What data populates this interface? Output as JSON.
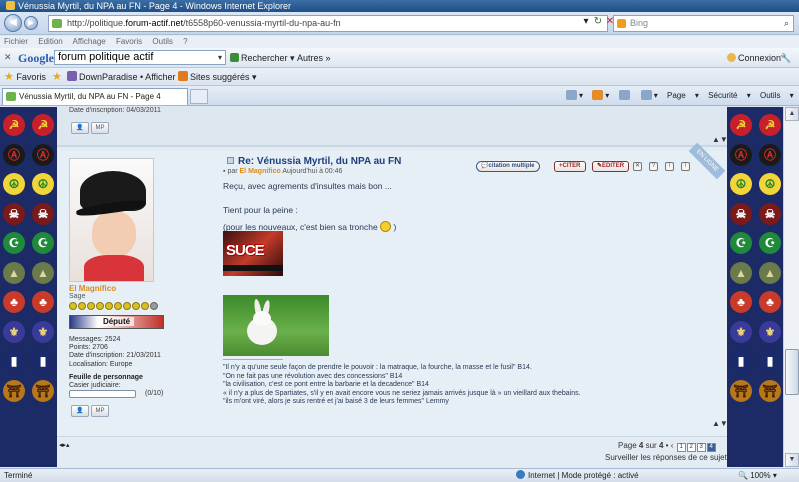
{
  "window": {
    "title": "Vénussia Myrtil, du NPA au FN - Page 4 - Windows Internet Explorer"
  },
  "address_bar": {
    "url_prefix": "http://politique.",
    "url_domain": "forum-actif.net",
    "url_rest": "/t6558p60-venussia-myrtil-du-npa-au-fn",
    "search_engine": "Bing"
  },
  "menu": [
    "Fichier",
    "Edition",
    "Affichage",
    "Favoris",
    "Outils",
    "?"
  ],
  "google_toolbar": {
    "logo": "Google",
    "query": "forum politique actif",
    "search_label": "Rechercher",
    "others_label": "Autres",
    "connect_label": "Connexion"
  },
  "favorites_bar": {
    "favorites_label": "Favoris",
    "items": [
      "DownParadise • Afficher l...",
      "Sites suggérés"
    ]
  },
  "tabs": {
    "active": "Vénussia Myrtil, du NPA au FN - Page 4"
  },
  "command_bar": {
    "page": "Page",
    "security": "Sécurité",
    "tools": "Outils"
  },
  "previous_post": {
    "registration_date": "Date d'inscription: 04/03/2011"
  },
  "post": {
    "title": "Re: Vénussia Myrtil, du NPA au FN",
    "by_label": "par",
    "author": "El Magnifico",
    "time": "Aujourd'hui à 00:46",
    "actions": {
      "multi_quote": "citation multiple",
      "quote": "CITER",
      "edit": "EDITER"
    },
    "online_badge": "EN LIGNE",
    "line1": "Reçu, avec agrements d'insultes mais bon ...",
    "line2": "Tient pour la peine :",
    "line3_start": "(pour les nouveaux, c'est bien sa tronche",
    "line3_end": ")",
    "image1_text": "SUCE",
    "signature": [
      "\"Il n'y a qu'une seule façon de prendre le pouvoir : la matraque, la fourche, la masse et le fusil\" B14.",
      "\"On ne fait pas une révolution avec des concessions\" B14",
      "\"la civilisation, c'est ce pont entre la barbarie et la decadence\" B14",
      "« il n'y a plus de Spartiates, s'il y en avait encore vous ne seriez jamais arrivés jusque là » un vieillard aux thebains.",
      "\"ils m'ont viré, alors je suis rentré et j'ai baisé 3 de leurs femmes\" Lemmy"
    ]
  },
  "profile": {
    "username": "El Magnifico",
    "rank": "Sage",
    "stars_total": 10,
    "stars_filled": 9,
    "badge": "Député",
    "messages": "Messages: 2524",
    "points": "Points: 2706",
    "registration": "Date d'inscription: 21/03/2011",
    "location": "Localisation: Europe",
    "sheet_title": "Feuille de personnage",
    "record_label": "Casier judiciaire:",
    "record_value": "(0/10)",
    "record_fraction": 0
  },
  "pagination": {
    "label_page": "Page",
    "current": "4",
    "of": "sur",
    "total": "4",
    "pages": [
      "1",
      "2",
      "3",
      "4"
    ],
    "watch": "Surveiller les réponses de ce sujet"
  },
  "status_bar": {
    "left": "Terminé",
    "zone": "Internet | Mode protégé : activé",
    "zoom": "100%"
  },
  "background_icons": [
    "hammer-sickle",
    "anarchy",
    "peace",
    "skull",
    "crescent",
    "pyramid",
    "tree",
    "fleur-de-lis",
    "flag",
    "gate"
  ]
}
